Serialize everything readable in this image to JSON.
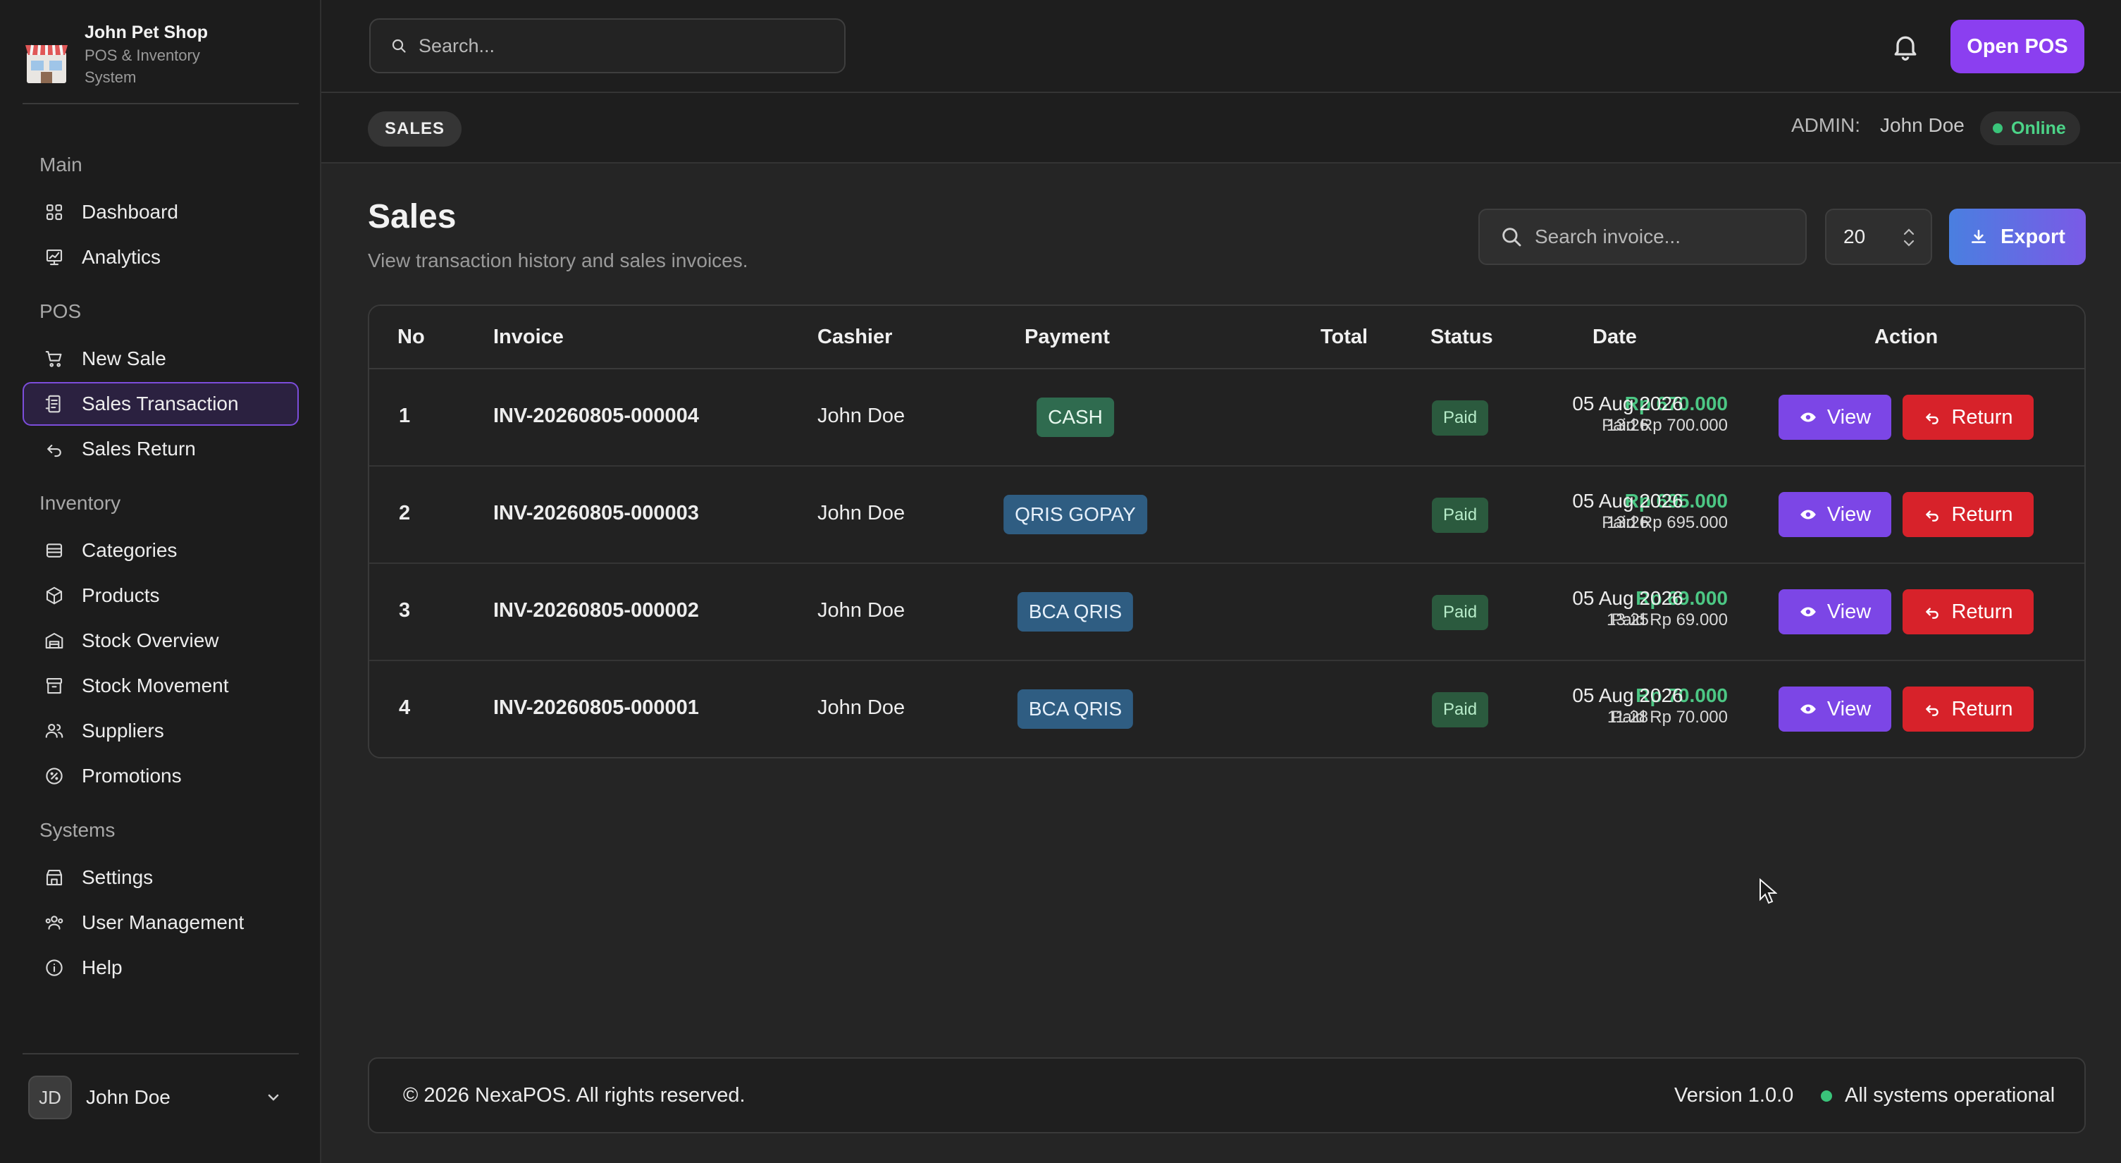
{
  "brand": {
    "name": "John Pet Shop",
    "subtitle": "POS & Inventory System"
  },
  "sidebar": {
    "sections": [
      {
        "label": "Main",
        "items": [
          {
            "label": "Dashboard",
            "icon": "grid-icon"
          },
          {
            "label": "Analytics",
            "icon": "chart-icon"
          }
        ]
      },
      {
        "label": "POS",
        "items": [
          {
            "label": "New Sale",
            "icon": "cart-icon"
          },
          {
            "label": "Sales Transaction",
            "icon": "receipt-icon",
            "active": true
          },
          {
            "label": "Sales Return",
            "icon": "undo-icon"
          }
        ]
      },
      {
        "label": "Inventory",
        "items": [
          {
            "label": "Categories",
            "icon": "layers-icon"
          },
          {
            "label": "Products",
            "icon": "box-icon"
          },
          {
            "label": "Stock Overview",
            "icon": "warehouse-icon"
          },
          {
            "label": "Stock Movement",
            "icon": "archive-icon"
          },
          {
            "label": "Suppliers",
            "icon": "users-icon"
          },
          {
            "label": "Promotions",
            "icon": "percent-badge-icon"
          }
        ]
      },
      {
        "label": "Systems",
        "items": [
          {
            "label": "Settings",
            "icon": "store-settings-icon"
          },
          {
            "label": "User Management",
            "icon": "user-group-icon"
          },
          {
            "label": "Help",
            "icon": "info-icon"
          }
        ]
      }
    ],
    "user": {
      "initials": "JD",
      "name": "John Doe"
    }
  },
  "topbar": {
    "search_placeholder": "Search...",
    "open_pos_label": "Open POS"
  },
  "subbar": {
    "breadcrumb": "SALES",
    "admin_label": "ADMIN:",
    "admin_name": "John Doe",
    "status": "Online"
  },
  "main": {
    "title": "Sales",
    "subtitle": "View transaction history and sales invoices.",
    "invoice_search_placeholder": "Search invoice...",
    "per_page": "20",
    "export_label": "Export",
    "columns": [
      "No",
      "Invoice",
      "Cashier",
      "Payment",
      "Total",
      "Status",
      "Date",
      "Action"
    ],
    "rows": [
      {
        "no": "1",
        "invoice": "INV-20260805-000004",
        "cashier": "John Doe",
        "payment": "CASH",
        "total": "Rp 670.000",
        "paid": "Paid Rp 700.000",
        "status": "Paid",
        "date": "05 Aug 2026",
        "time": "13:26"
      },
      {
        "no": "2",
        "invoice": "INV-20260805-000003",
        "cashier": "John Doe",
        "payment": "QRIS GOPAY",
        "total": "Rp 695.000",
        "paid": "Paid Rp 695.000",
        "status": "Paid",
        "date": "05 Aug 2026",
        "time": "13:26"
      },
      {
        "no": "3",
        "invoice": "INV-20260805-000002",
        "cashier": "John Doe",
        "payment": "BCA QRIS",
        "total": "Rp 69.000",
        "paid": "Paid Rp 69.000",
        "status": "Paid",
        "date": "05 Aug 2026",
        "time": "13:25"
      },
      {
        "no": "4",
        "invoice": "INV-20260805-000001",
        "cashier": "John Doe",
        "payment": "BCA QRIS",
        "total": "Rp 70.000",
        "paid": "Paid Rp 70.000",
        "status": "Paid",
        "date": "05 Aug 2026",
        "time": "11:28"
      }
    ],
    "view_label": "View",
    "return_label": "Return"
  },
  "footer": {
    "copyright": "© 2026 NexaPOS. All rights reserved.",
    "version": "Version 1.0.0",
    "system_status": "All systems operational"
  },
  "colors": {
    "accent": "#8b3ff0",
    "success": "#4cc784",
    "danger": "#d7222a",
    "background": "#252525"
  }
}
